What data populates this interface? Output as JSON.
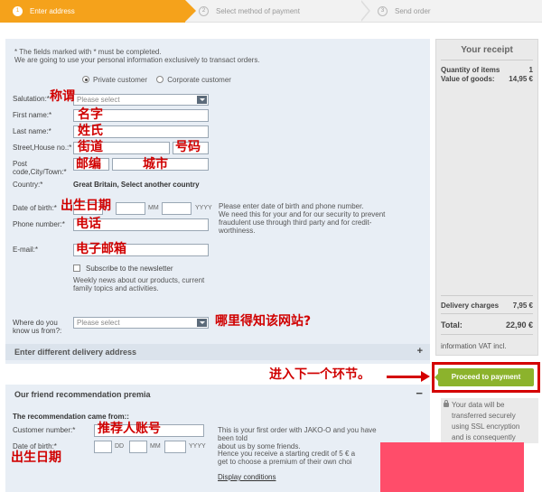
{
  "steps": [
    {
      "num": "1",
      "label": "Enter address"
    },
    {
      "num": "2",
      "label": "Select method of payment"
    },
    {
      "num": "3",
      "label": "Send order"
    }
  ],
  "form": {
    "intro_line1": "* The fields marked with * must be completed.",
    "intro_line2": "We are going to use your personal information exclusively to transact orders.",
    "private_customer": "Private customer",
    "corporate_customer": "Corporate customer",
    "salutation_label": "Salutation:*",
    "salutation_placeholder": "Please select",
    "firstname_label": "First name:*",
    "lastname_label": "Last name:*",
    "street_label": "Street,House no.:*",
    "post_label_1": "Post",
    "post_label_2": "code,City/Town:*",
    "country_label": "Country:*",
    "country_value": "Great Britain,",
    "country_other": "Select another country",
    "dob_label": "Date of birth:*",
    "dob_mm": "MM",
    "dob_yyyy": "YYYY",
    "phone_label": "Phone number:*",
    "dob_help_1": "Please enter date of birth and phone number.",
    "dob_help_2": "We need this for your and for our security to prevent",
    "dob_help_3": "fraudulent use through third party and for credit-",
    "dob_help_4": "worthiness.",
    "email_label": "E-mail:*",
    "newsletter_label": "Subscribe to the newsletter",
    "newsletter_desc_1": "Weekly news about our products, current",
    "newsletter_desc_2": "family topics and activities.",
    "where_label_1": "Where do you",
    "where_label_2": "know us from?:",
    "where_placeholder": "Please select"
  },
  "delivery": {
    "title": "Enter different delivery address",
    "toggle": "+"
  },
  "friend": {
    "title": "Our friend recommendation premia",
    "toggle": "−",
    "subtitle": "The recommendation came from::",
    "customer_number_label": "Customer number:*",
    "dob_label": "Date of birth:*",
    "dd": "DD",
    "mm": "MM",
    "yyyy": "YYYY",
    "info_1": "This is your first order with JAKO-O and you have been told",
    "info_2": "about us by some friends.",
    "info_3": "Hence you receive a starting credit of 5 € a",
    "info_4": "get to choose a premium of their own choi",
    "conditions_link": "Display conditions"
  },
  "receipt": {
    "title": "Your receipt",
    "qty_label": "Quantity of items",
    "qty_value": "1",
    "goods_label": "Value of goods:",
    "goods_value": "14,95 €",
    "delivery_label": "Delivery charges",
    "delivery_value": "7,95 €",
    "total_label": "Total:",
    "total_value": "22,90 €",
    "vat_note": "information VAT incl."
  },
  "proceed_label": "Proceed to payment",
  "secure_note": [
    "Your data will be",
    "transferred securely",
    "using SSL encryption",
    "and is consequently"
  ],
  "annotations": {
    "salutation": "称谓",
    "first_name": "名字",
    "last_name": "姓氏",
    "street": "街道",
    "house_no": "号码",
    "post_code": "邮编",
    "city": "城市",
    "dob": "出生日期",
    "phone": "电话",
    "email": "电子邮箱",
    "where": "哪里得知该网站?",
    "next_step": "进入下一个环节。",
    "referrer": "推荐人账号",
    "friend_dob": "出生日期"
  },
  "colors": {
    "accent": "#f5a21b",
    "proceed": "#8cb32c",
    "annotation": "#d40000",
    "panel": "#e8eef5"
  }
}
